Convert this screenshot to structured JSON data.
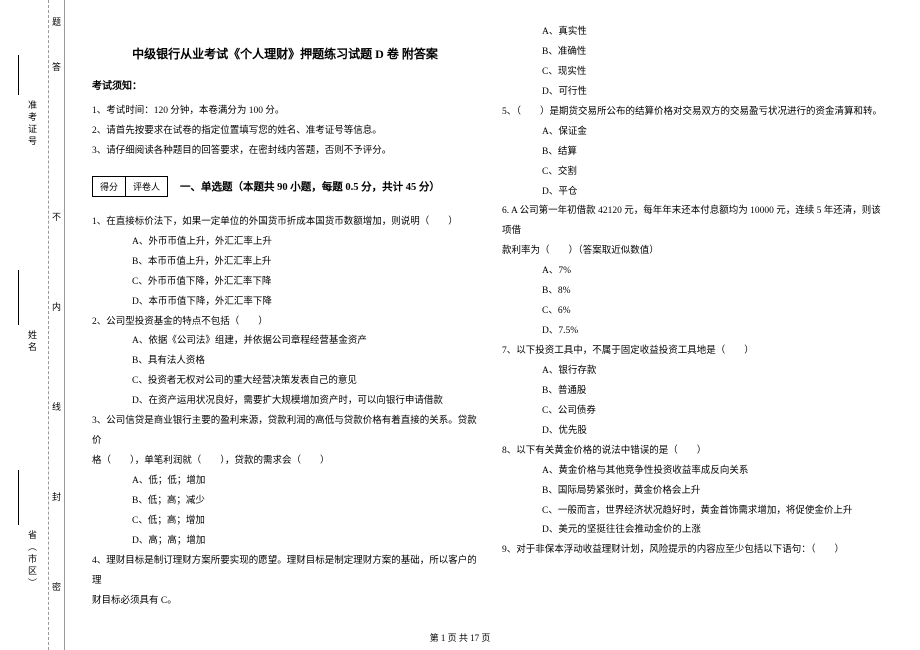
{
  "binding": {
    "province": "省（市区）",
    "name": "姓名",
    "ticket": "准考证号",
    "seal": [
      "密",
      "封",
      "线",
      "内",
      "不",
      "答",
      "题"
    ]
  },
  "title": "中级银行从业考试《个人理财》押题练习试题 D 卷 附答案",
  "notice": {
    "heading": "考试须知：",
    "items": [
      "1、考试时间：120 分钟，本卷满分为 100 分。",
      "2、请首先按要求在试卷的指定位置填写您的姓名、准考证号等信息。",
      "3、请仔细阅读各种题目的回答要求，在密封线内答题，否则不予评分。"
    ]
  },
  "score": {
    "a": "得分",
    "b": "评卷人"
  },
  "section1": "一、单选题（本题共 90 小题，每题 0.5 分，共计 45 分）",
  "left": {
    "q1": "1、在直接标价法下，如果一定单位的外国货币折成本国货币数额增加，则说明（　　）",
    "q1a": "A、外币币值上升，外汇汇率上升",
    "q1b": "B、本币币值上升，外汇汇率上升",
    "q1c": "C、外币币值下降，外汇汇率下降",
    "q1d": "D、本币币值下降，外汇汇率下降",
    "q2": "2、公司型投资基金的特点不包括（　　）",
    "q2a": "A、依据《公司法》组建，并依据公司章程经营基金资产",
    "q2b": "B、具有法人资格",
    "q2c": "C、投资者无权对公司的重大经营决策发表自己的意见",
    "q2d": "D、在资产运用状况良好，需要扩大规模增加资产时，可以向银行申请借款",
    "q3": "3、公司信贷是商业银行主要的盈利来源，贷款利润的高低与贷款价格有着直接的关系。贷款价",
    "q3b": "格（　　），单笔利润就（　　），贷款的需求会（　　）",
    "q3a1": "A、低；低；增加",
    "q3a2": "B、低；高；减少",
    "q3a3": "C、低；高；增加",
    "q3a4": "D、高；高；增加",
    "q4": "4、理财目标是制订理财方案所要实现的愿望。理财目标是制定理财方案的基础，所以客户的理",
    "q4b": "财目标必须具有 C。"
  },
  "right": {
    "q4a": "A、真实性",
    "q4b2": "B、准确性",
    "q4c": "C、现实性",
    "q4d": "D、可行性",
    "q5": "5、（　　）是期货交易所公布的结算价格对交易双方的交易盈亏状况进行的资金清算和转。",
    "q5a": "A、保证金",
    "q5b": "B、结算",
    "q5c": "C、交割",
    "q5d": "D、平仓",
    "q6": "6. A 公司第一年初借款 42120 元，每年年末还本付息额均为 10000 元，连续 5 年还清，则该项借",
    "q6b": "款利率为（　　）（答案取近似数值）",
    "q6a1": "A、7%",
    "q6a2": "B、8%",
    "q6a3": "C、6%",
    "q6a4": "D、7.5%",
    "q7": "7、以下投资工具中，不属于固定收益投资工具地是（　　）",
    "q7a": "A、银行存款",
    "q7b": "B、普通股",
    "q7c": "C、公司债券",
    "q7d": "D、优先股",
    "q8": "8、以下有关黄金价格的说法中错误的是（　　）",
    "q8a": "A、黄金价格与其他竞争性投资收益率成反向关系",
    "q8b": "B、国际局势紧张时，黄金价格会上升",
    "q8c": "C、一般而言，世界经济状况趋好时，黄金首饰需求增加，将促使金价上升",
    "q8d": "D、美元的坚挺往往会推动金价的上涨",
    "q9": "9、对于非保本浮动收益理财计划，风险提示的内容应至少包括以下语句：（　　）"
  },
  "footer": "第 1 页 共 17 页"
}
